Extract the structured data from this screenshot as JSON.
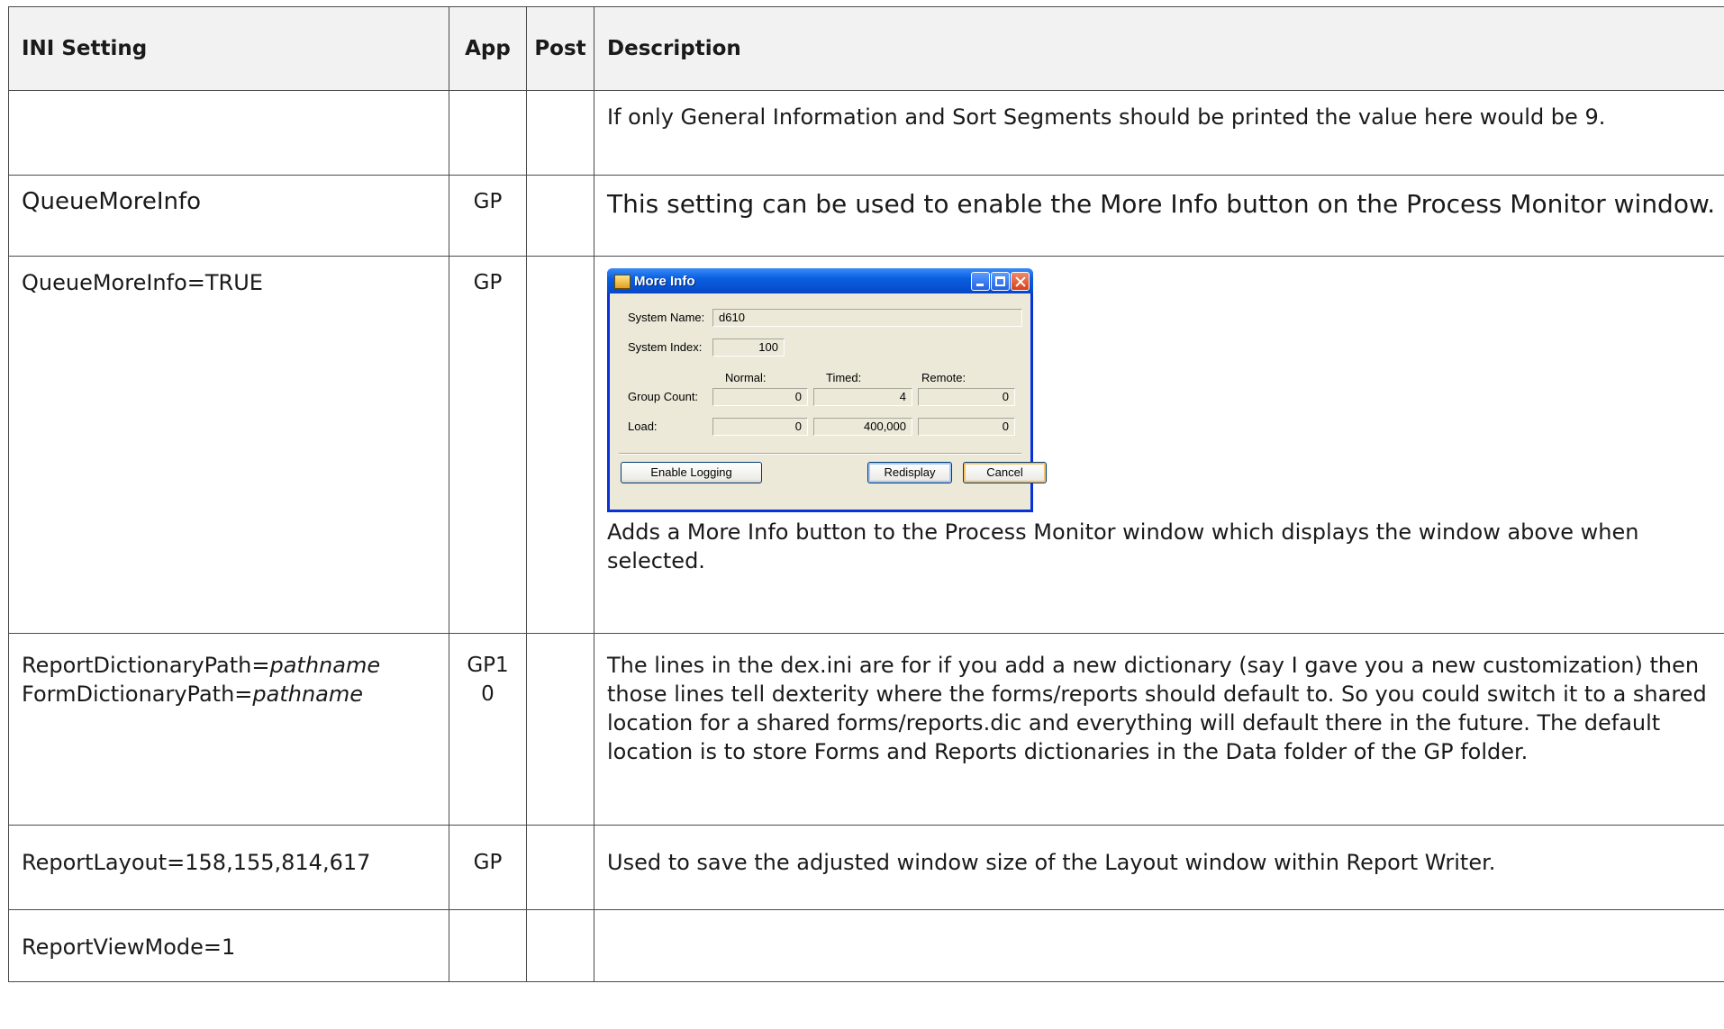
{
  "headers": {
    "setting": "INI Setting",
    "app": "App",
    "post": "Post",
    "description": "Description"
  },
  "rows": [
    {
      "setting": "",
      "app": "",
      "post": "",
      "description": "If only General Information and Sort Segments should be printed the value here would be 9."
    },
    {
      "setting": "QueueMoreInfo",
      "app": "GP",
      "post": "",
      "description": "This setting can be used to enable the More Info button on the Process Monitor window."
    },
    {
      "setting": "QueueMoreInfo=TRUE",
      "app": "GP",
      "post": "",
      "description": "Adds a More Info button to the Process Monitor window which displays the window above when selected."
    },
    {
      "setting_line1_prefix": "ReportDictionaryPath=",
      "setting_line1_italic": "pathname",
      "setting_line2_prefix": "FormDictionaryPath=",
      "setting_line2_italic": "pathname",
      "app_line1": "GP1",
      "app_line2": "0",
      "post": "",
      "description": "The lines in the dex.ini are for if you add a new dictionary (say I gave you a new customization) then those lines tell dexterity where the forms/reports should default to.  So you could switch it to a shared location for a shared forms/reports.dic and everything will default there in the future. The default location is to store Forms and Reports dictionaries in the Data folder of the GP folder."
    },
    {
      "setting": "ReportLayout=158,155,814,617",
      "app": "GP",
      "post": "",
      "description": "Used to save the adjusted window size of the Layout window within Report Writer."
    },
    {
      "setting": "ReportViewMode=1",
      "app": "",
      "post": "",
      "description": ""
    }
  ],
  "dialog": {
    "title": "More Info",
    "system_name_label": "System Name:",
    "system_name_value": "d610",
    "system_index_label": "System Index:",
    "system_index_value": "100",
    "col_normal": "Normal:",
    "col_timed": "Timed:",
    "col_remote": "Remote:",
    "group_count_label": "Group Count:",
    "group_count_normal": "0",
    "group_count_timed": "4",
    "group_count_remote": "0",
    "load_label": "Load:",
    "load_normal": "0",
    "load_timed": "400,000",
    "load_remote": "0",
    "enable_logging": "Enable Logging",
    "redisplay": "Redisplay",
    "cancel": "Cancel"
  }
}
